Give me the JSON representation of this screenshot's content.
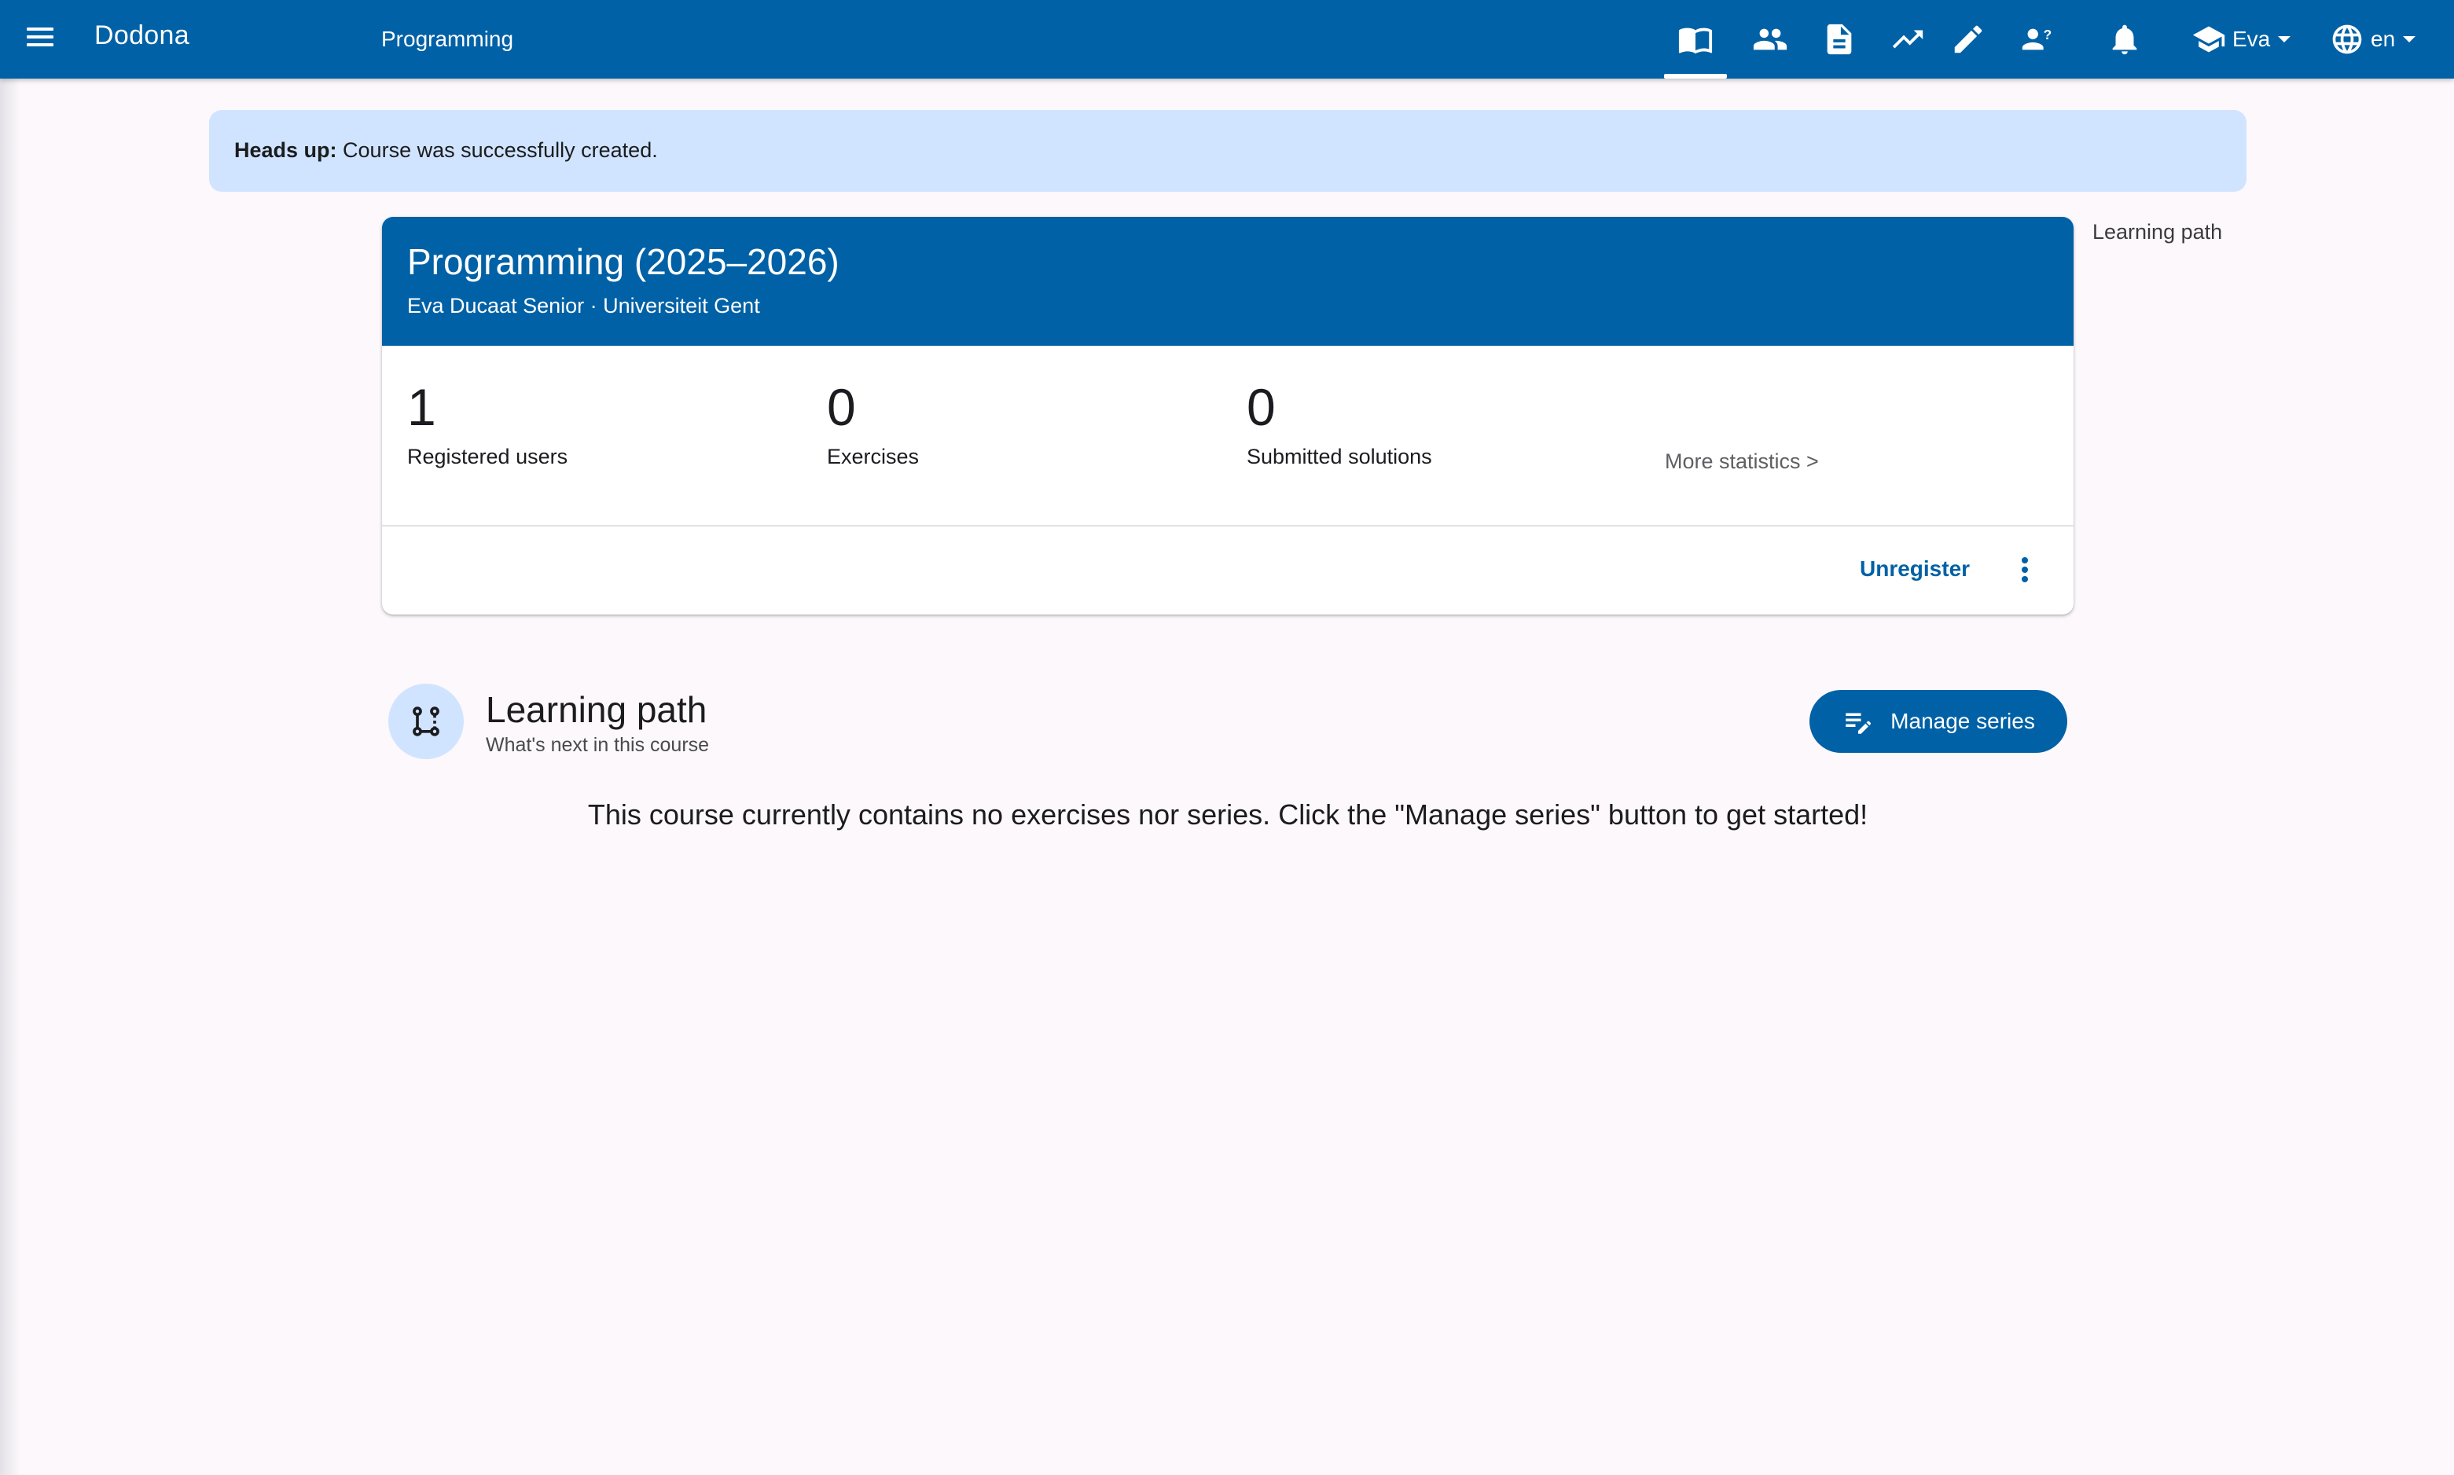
{
  "app": {
    "brand": "Dodona",
    "breadcrumb": "Programming"
  },
  "nav": {
    "icons": [
      "course-icon",
      "users-icon",
      "submissions-icon",
      "statistics-icon",
      "edit-icon",
      "questions-icon",
      "notifications-icon"
    ],
    "user_name": "Eva",
    "language": "en"
  },
  "alert": {
    "prefix": "Heads up:",
    "message": "Course was successfully created."
  },
  "course": {
    "title": "Programming (2025–2026)",
    "subtitle": "Eva Ducaat Senior · Universiteit Gent",
    "stats": [
      {
        "value": "1",
        "label": "Registered users"
      },
      {
        "value": "0",
        "label": "Exercises"
      },
      {
        "value": "0",
        "label": "Submitted solutions"
      }
    ],
    "more_statistics": "More statistics >",
    "unregister_label": "Unregister"
  },
  "side": {
    "learning_path_link": "Learning path"
  },
  "learning_path": {
    "title": "Learning path",
    "subtitle": "What's next in this course",
    "manage_button": "Manage series",
    "empty_message": "This course currently contains no exercises nor series. Click the \"Manage series\" button to get started!"
  },
  "colors": {
    "primary": "#0061a6",
    "alert_bg": "#d1e4ff",
    "background": "#fcf8fc"
  }
}
